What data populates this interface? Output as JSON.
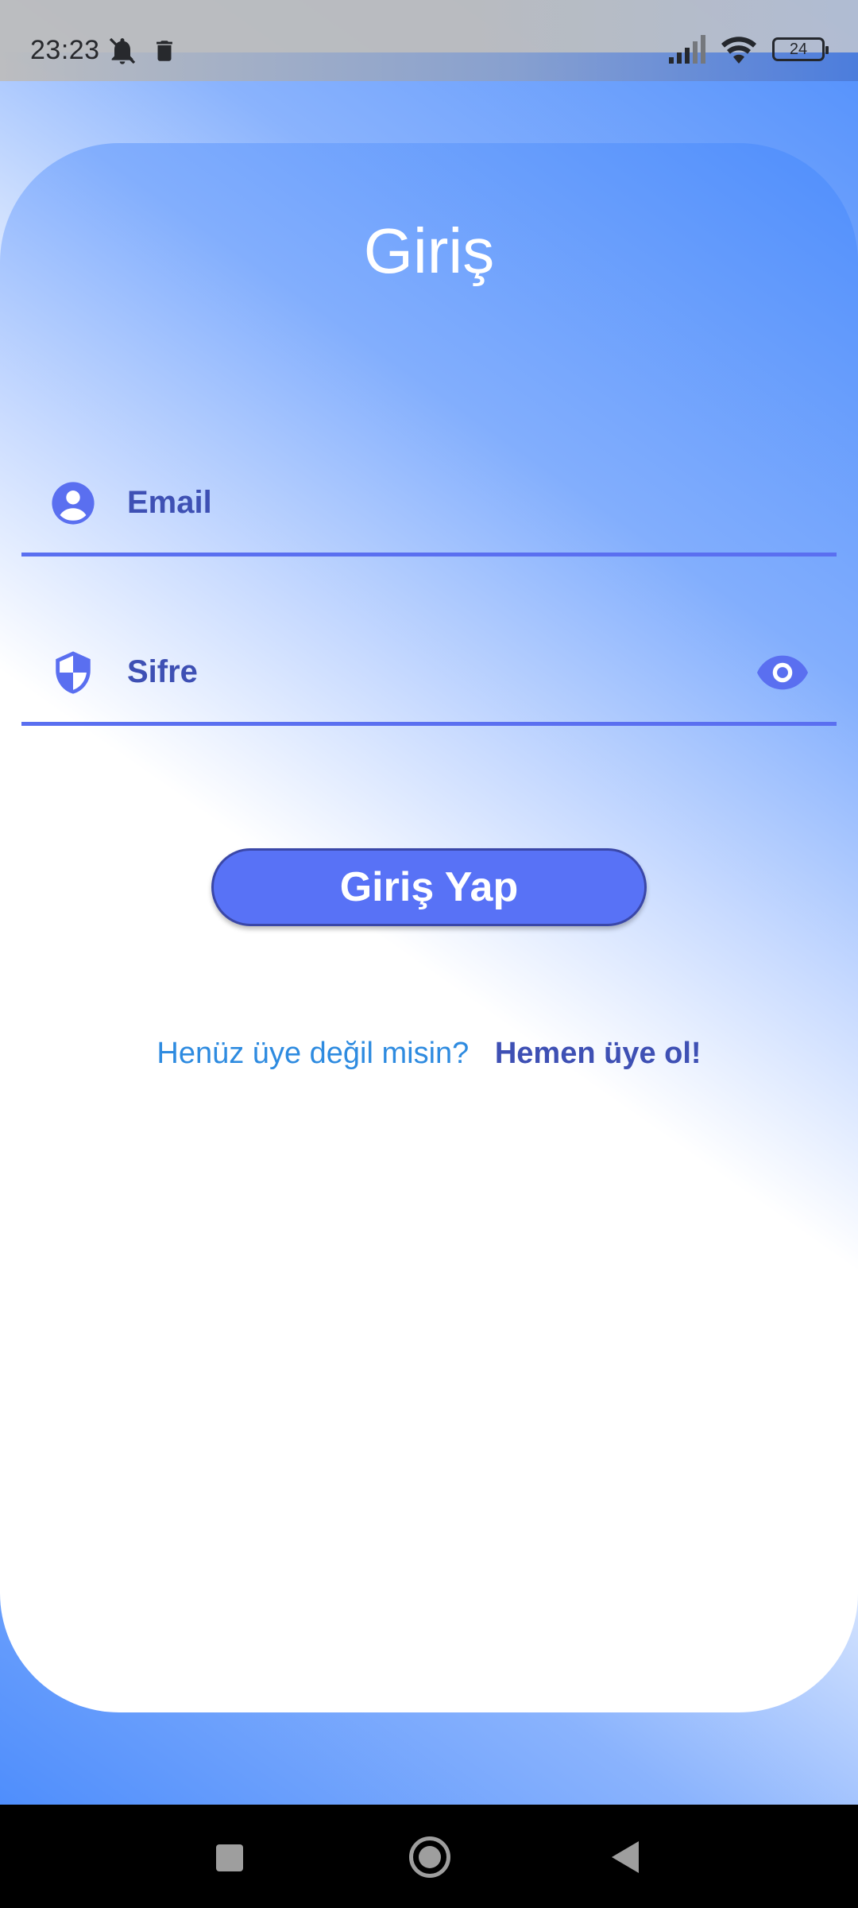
{
  "status_bar": {
    "time": "23:23",
    "battery": "24",
    "icons_left": [
      "muted-bell-icon",
      "trash-icon"
    ],
    "icons_right": [
      "signal-icon",
      "wifi-icon",
      "battery-icon"
    ]
  },
  "screen": {
    "title": "Giriş",
    "email_field": {
      "label": "Email",
      "icon": "account-circle-icon"
    },
    "password_field": {
      "label": "Sifre",
      "icon": "shield-icon",
      "toggle_icon": "eye-icon"
    },
    "login_button": "Giriş Yap",
    "register_prompt": "Henüz üye değil misin?",
    "register_link": "Hemen üye ol!"
  },
  "colors": {
    "accent": "#5872f6",
    "label": "#3e50b4",
    "prompt": "#2e8be0",
    "gradient_blue": "#4f8efc"
  },
  "nav_bar": {
    "buttons": [
      "recent-apps-icon",
      "home-icon",
      "back-icon"
    ]
  }
}
